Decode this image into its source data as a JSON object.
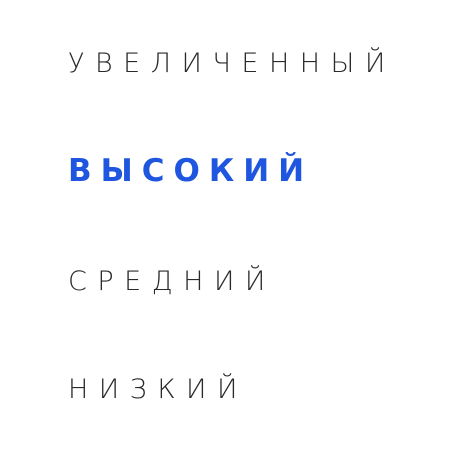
{
  "options": [
    {
      "label": "Увеличенный",
      "selected": false
    },
    {
      "label": "Высокий",
      "selected": true
    },
    {
      "label": "Средний",
      "selected": false
    },
    {
      "label": "Низкий",
      "selected": false
    }
  ],
  "colors": {
    "text": "#2a2a2a",
    "selected": "#1f56e0",
    "background": "#ffffff"
  }
}
